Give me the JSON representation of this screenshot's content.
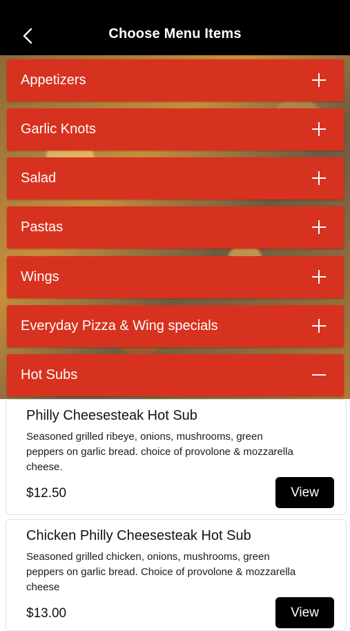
{
  "header": {
    "title": "Choose Menu Items",
    "back_icon": "chevron-left-icon"
  },
  "categories": [
    {
      "label": "Appetizers",
      "icon": "plus-icon"
    },
    {
      "label": "Garlic Knots",
      "icon": "plus-icon"
    },
    {
      "label": "Salad",
      "icon": "plus-icon"
    },
    {
      "label": "Pastas",
      "icon": "plus-icon"
    },
    {
      "label": "Wings",
      "icon": "plus-icon"
    },
    {
      "label": "Everyday Pizza & Wing specials",
      "icon": "plus-icon"
    },
    {
      "label": "Hot Subs",
      "icon": "minus-icon"
    }
  ],
  "items": [
    {
      "name": "Philly Cheesesteak Hot Sub",
      "description": "Seasoned grilled ribeye, onions, mushrooms, green peppers on garlic bread. choice of provolone & mozzarella cheese.",
      "price": "$12.50",
      "button": "View"
    },
    {
      "name": "Chicken Philly Cheesesteak Hot Sub",
      "description": "Seasoned grilled chicken, onions, mushrooms, green peppers on garlic bread. Choice of provolone & mozzarella cheese",
      "price": "$13.00",
      "button": "View"
    }
  ],
  "colors": {
    "accent": "#d7321f",
    "header": "#000000",
    "button": "#000000"
  }
}
